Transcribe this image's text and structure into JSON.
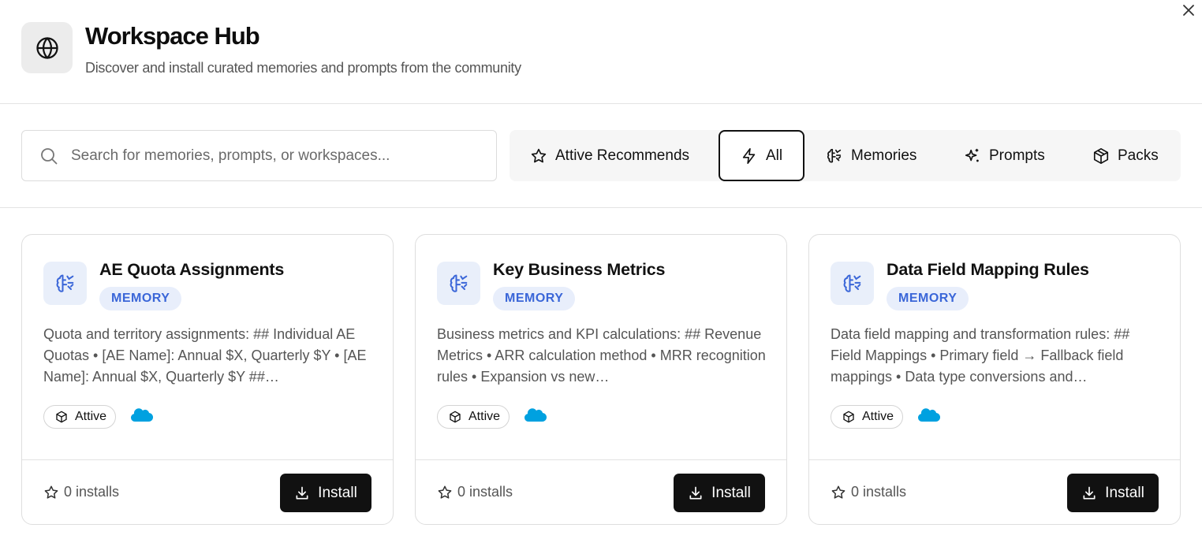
{
  "header": {
    "title": "Workspace Hub",
    "subtitle": "Discover and install curated memories and prompts from the community",
    "icon": "globe-icon"
  },
  "close": {
    "icon": "close-icon"
  },
  "search": {
    "placeholder": "Search for memories, prompts, or workspaces...",
    "value": ""
  },
  "filters": [
    {
      "label": "Attive Recommends",
      "icon": "star-icon",
      "active": false
    },
    {
      "label": "All",
      "icon": "lightning-icon",
      "active": true
    },
    {
      "label": "Memories",
      "icon": "brain-icon",
      "active": false
    },
    {
      "label": "Prompts",
      "icon": "sparkles-icon",
      "active": false
    },
    {
      "label": "Packs",
      "icon": "package-icon",
      "active": false
    }
  ],
  "cards": [
    {
      "title": "AE Quota Assignments",
      "type": "MEMORY",
      "description": "Quota and territory assignments: ## Individual AE Quotas • [AE Name]: Annual $X, Quarterly $Y • [AE Name]: Annual $X, Quarterly $Y ##…",
      "source": "Attive",
      "integration": "salesforce-cloud-icon",
      "installs": "0 installs",
      "install_label": "Install"
    },
    {
      "title": "Key Business Metrics",
      "type": "MEMORY",
      "description": "Business metrics and KPI calculations: ## Revenue Metrics • ARR calculation method • MRR recognition rules • Expansion vs new…",
      "source": "Attive",
      "integration": "salesforce-cloud-icon",
      "installs": "0 installs",
      "install_label": "Install"
    },
    {
      "title": "Data Field Mapping Rules",
      "type": "MEMORY",
      "description": "Data field mapping and transformation rules: ## Field Mappings • Primary field → Fallback field mappings • Data type conversions and…",
      "source": "Attive",
      "integration": "salesforce-cloud-icon",
      "installs": "0 installs",
      "install_label": "Install"
    }
  ],
  "colors": {
    "accent_badge_text": "#3a66d8",
    "accent_badge_bg": "#e8eefb",
    "button_bg": "#111111",
    "salesforce_blue": "#00a1e0"
  }
}
